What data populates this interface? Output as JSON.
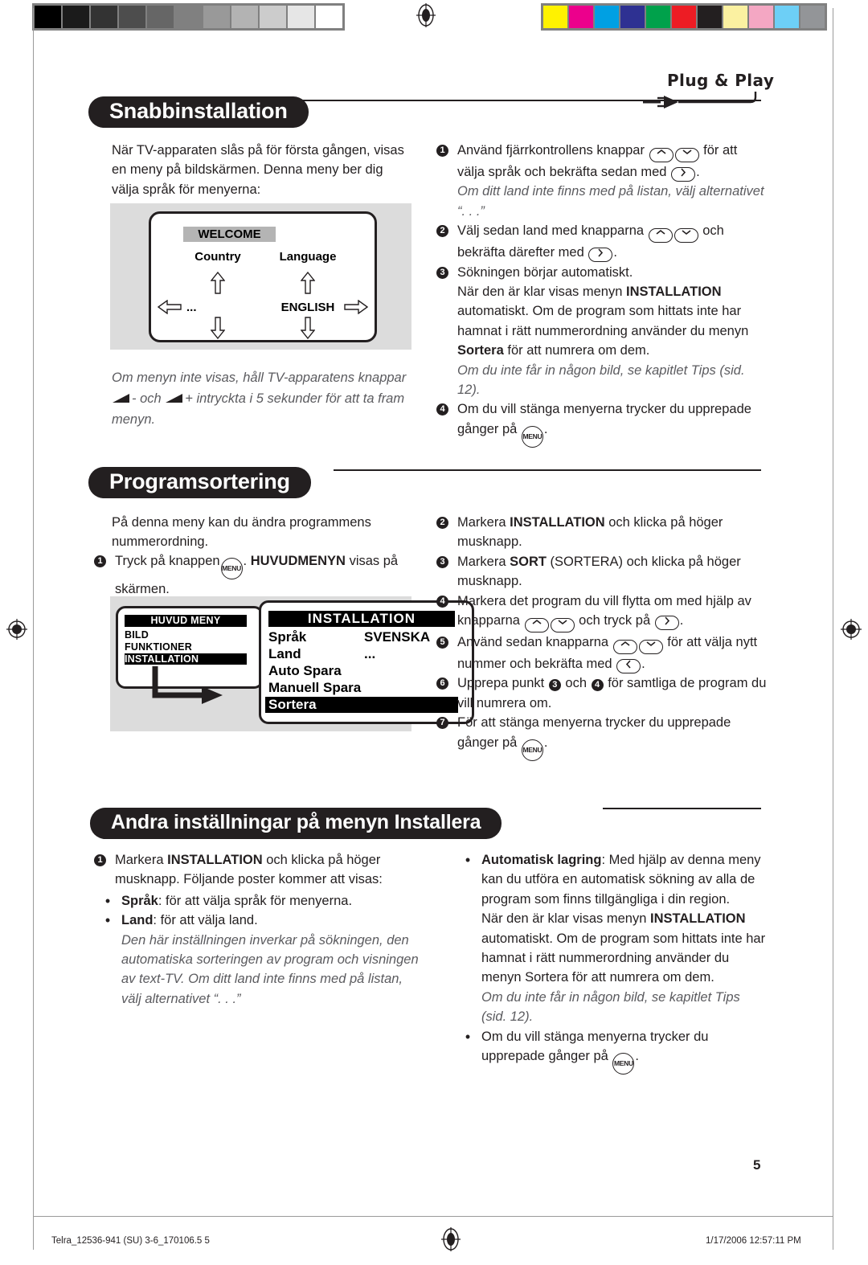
{
  "calibration": {
    "grayscale": [
      "#000000",
      "#1b1b1b",
      "#333333",
      "#4d4d4d",
      "#666666",
      "#808080",
      "#999999",
      "#b3b3b3",
      "#cccccc",
      "#e6e6e6",
      "#ffffff"
    ],
    "colorbars": [
      "#fff200",
      "#ec008c",
      "#00a0e3",
      "#2e3192",
      "#00a14b",
      "#ed1c24",
      "#231f20",
      "#fbf1a1",
      "#f4a7c3",
      "#6dcff6",
      "#939598"
    ]
  },
  "logo": {
    "text": "Plug & Play",
    "icon": "power-plug-icon"
  },
  "sections": [
    {
      "title": "Snabbinstallation",
      "intro": "När TV-apparaten slås på för första gången, visas en meny på bildskärmen. Denna meny ber dig välja språk för menyerna:",
      "figure": {
        "title": "WELCOME",
        "col1_label": "Country",
        "col1_value": "...",
        "col2_label": "Language",
        "col2_value": "ENGLISH"
      },
      "caption_prefix": "Om menyn inte visas, håll TV-apparatens knappar ",
      "caption_mid": "- och ",
      "caption_mid2": "+ intryckta i 5 sekunder för att ta fram menyn.",
      "steps": [
        {
          "n": "1",
          "parts": [
            "Använd fjärrkontrollens knappar ",
            "KEY_UP",
            "KEY_DOWN",
            " för att välja språk och bekräfta sedan med ",
            "KEY_RIGHT",
            "."
          ],
          "note": "Om ditt land inte finns med på listan, välj alternativet “. . .”"
        },
        {
          "n": "2",
          "parts": [
            "Välj sedan land med knapparna ",
            "KEY_UP",
            "KEY_DOWN",
            " och bekräfta därefter med ",
            "KEY_RIGHT",
            "."
          ]
        },
        {
          "n": "3",
          "line1": "Sökningen börjar automatiskt.",
          "line2_a": "När den är klar visas menyn ",
          "line2_b": "INSTALLATION",
          "line2_c": " automatiskt. Om de program som hittats inte har hamnat i rätt nummerordning använder du menyn ",
          "line2_d": "Sortera",
          "line2_e": " för att numrera om dem.",
          "note": "Om du inte får in någon bild, se kapitlet Tips (sid. 12)."
        },
        {
          "n": "4",
          "parts": [
            "Om du vill stänga menyerna trycker du upprepade gånger på ",
            "KEY_MENU",
            "."
          ]
        }
      ]
    },
    {
      "title": "Programsortering",
      "intro": "På denna meny kan du ändra programmens nummerordning.",
      "figure": {
        "main_menu_title": "HUVUD MENY",
        "main_menu_items": [
          "BILD",
          "FUNKTIONER",
          "INSTALLATION"
        ],
        "main_menu_selected": "INSTALLATION",
        "install_title": "INSTALLATION",
        "install_rows": [
          {
            "label": "Språk",
            "value": "SVENSKA"
          },
          {
            "label": "Land",
            "value": "..."
          },
          {
            "label": "Auto Spara",
            "value": ""
          },
          {
            "label": "Manuell Spara",
            "value": ""
          },
          {
            "label": "Sortera",
            "value": ""
          }
        ],
        "install_selected": "Sortera"
      },
      "steps": [
        {
          "n": "1",
          "a": "Tryck på knappen",
          "key": "KEY_MENU",
          "b": ". ",
          "bold": "HUVUDMENYN",
          "c": " visas på skärmen."
        },
        {
          "n": "2",
          "a": "Markera ",
          "bold": "INSTALLATION",
          "c": " och klicka på höger musknapp."
        },
        {
          "n": "3",
          "a": "Markera ",
          "bold": "SORT",
          "c": " (SORTERA) och klicka på höger musknapp."
        },
        {
          "n": "4",
          "parts": [
            "Markera det program du vill flytta om med hjälp av knapparna ",
            "KEY_UP",
            "KEY_DOWN",
            " och tryck på ",
            "KEY_RIGHT",
            "."
          ]
        },
        {
          "n": "5",
          "parts": [
            "Använd sedan knapparna ",
            "KEY_UP",
            "KEY_DOWN",
            " för att välja nytt nummer och bekräfta med ",
            "KEY_LEFT",
            "."
          ]
        },
        {
          "n": "6",
          "a": "Upprepa punkt ",
          "inum1": "3",
          "b": " och ",
          "inum2": "4",
          "c": " för samtliga de program du vill numrera om."
        },
        {
          "n": "7",
          "parts": [
            "För att stänga menyerna trycker du upprepade gånger på ",
            "KEY_MENU",
            "."
          ]
        }
      ]
    },
    {
      "title": "Andra inställningar på menyn Installera",
      "left": {
        "step_n": "1",
        "step_a": "Markera ",
        "step_bold": "INSTALLATION",
        "step_c": " och klicka på höger musknapp. Följande poster kommer att visas:",
        "bullets": [
          {
            "bold": "Språk",
            "text": ": för att välja språk för menyerna."
          },
          {
            "bold": "Land",
            "text": ": för att välja land.",
            "note": "Den här inställningen inverkar på sökningen, den automatiska sorteringen av program och visningen av text-TV. Om ditt land inte finns med på listan, välj alternativet “. . .”"
          }
        ]
      },
      "right": {
        "bullets": [
          {
            "bold": "Automatisk lagring",
            "text": ": Med hjälp av denna meny kan du utföra en automatisk sökning av alla de program som finns tillgängliga i din region.",
            "cont_a": "När den är klar visas menyn ",
            "cont_bold": "INSTALLATION",
            "cont_b": " automatiskt. Om de program som hittats inte har hamnat i rätt nummerordning använder du menyn Sortera för att numrera om dem.",
            "note": "Om du inte får in någon bild, se kapitlet Tips (sid. 12)."
          },
          {
            "text_a": "Om du vill stänga menyerna trycker du upprepade gånger på ",
            "key": "KEY_MENU",
            "text_b": "."
          }
        ]
      }
    }
  ],
  "page_number": "5",
  "footer": {
    "left": "Telra_12536-941 (SU) 3-6_170106.5   5",
    "right": "1/17/2006   12:57:11 PM"
  }
}
